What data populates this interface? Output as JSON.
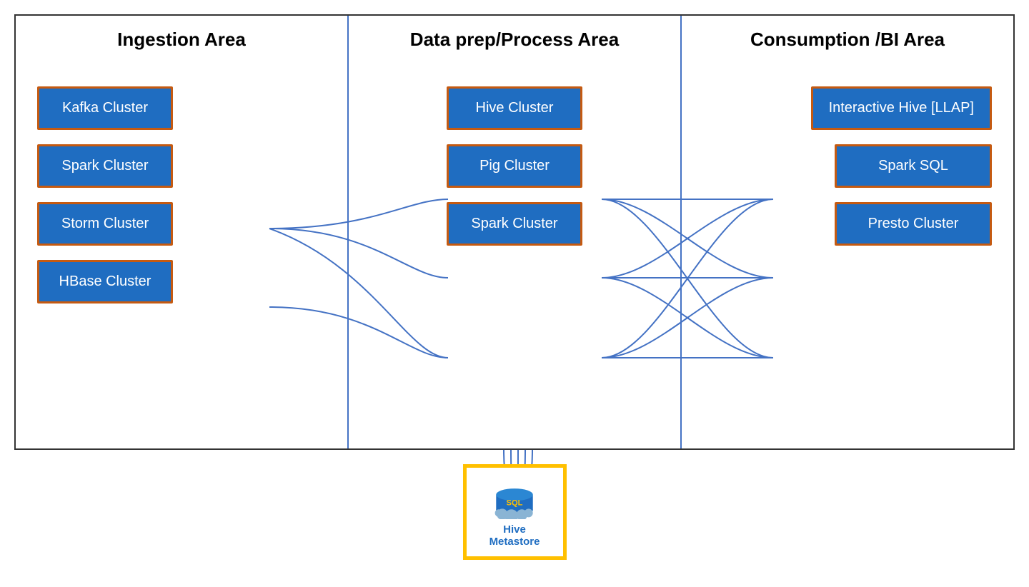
{
  "columns": {
    "ingestion": {
      "title": "Ingestion Area",
      "clusters": [
        {
          "label": "Kafka Cluster"
        },
        {
          "label": "Spark Cluster"
        },
        {
          "label": "Storm Cluster"
        },
        {
          "label": "HBase Cluster"
        }
      ]
    },
    "process": {
      "title": "Data prep/Process Area",
      "clusters": [
        {
          "label": "Hive Cluster"
        },
        {
          "label": "Pig Cluster"
        },
        {
          "label": "Spark Cluster"
        }
      ]
    },
    "consumption": {
      "title": "Consumption /BI Area",
      "clusters": [
        {
          "label": "Interactive Hive [LLAP]"
        },
        {
          "label": "Spark SQL"
        },
        {
          "label": "Presto Cluster"
        }
      ]
    }
  },
  "metastore": {
    "label": "Hive Metastore",
    "sql_text": "SQL"
  },
  "colors": {
    "cluster_bg": "#1f6dc1",
    "cluster_border": "#c55a11",
    "line_color": "#4472c4",
    "metastore_border": "#ffc000",
    "title_color": "#000000"
  }
}
